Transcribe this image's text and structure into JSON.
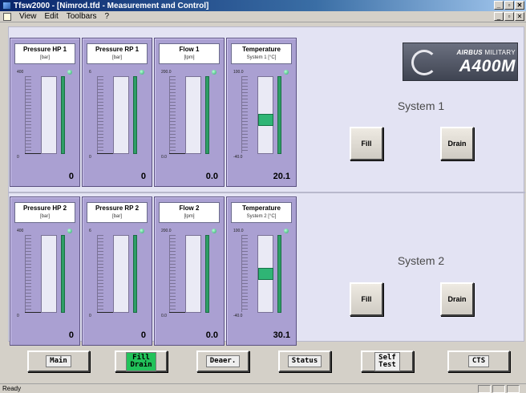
{
  "window": {
    "title": "Tfsw2000 - [Nimrod.tfd - Measurement and Control]"
  },
  "menu": {
    "items": [
      "View",
      "Edit",
      "Toolbars",
      "?"
    ]
  },
  "logo": {
    "brand": "AIRBUS",
    "brand_suffix": "MILITARY",
    "model": "A400M"
  },
  "systems": [
    {
      "title": "System 1",
      "fill_label": "Fill",
      "drain_label": "Drain",
      "gauges": [
        {
          "title": "Pressure HP 1",
          "unit": "[bar]",
          "max": "400",
          "min": "0",
          "value": "0",
          "level": 0
        },
        {
          "title": "Pressure RP 1",
          "unit": "[bar]",
          "max": "6",
          "min": "0",
          "value": "0",
          "level": 0
        },
        {
          "title": "Flow 1",
          "unit": "[lpm]",
          "max": "200.0",
          "min": "0.0",
          "value": "0.0",
          "level": 0
        },
        {
          "title": "Temperature",
          "unit": "System 1 [°C]",
          "max": "100.0",
          "min": "-40.0",
          "value": "20.1",
          "level": 0.43
        }
      ]
    },
    {
      "title": "System 2",
      "fill_label": "Fill",
      "drain_label": "Drain",
      "gauges": [
        {
          "title": "Pressure HP 2",
          "unit": "[bar]",
          "max": "400",
          "min": "0",
          "value": "0",
          "level": 0
        },
        {
          "title": "Pressure RP 2",
          "unit": "[bar]",
          "max": "6",
          "min": "0",
          "value": "0",
          "level": 0
        },
        {
          "title": "Flow 2",
          "unit": "[lpm]",
          "max": "200.0",
          "min": "0.0",
          "value": "0.0",
          "level": 0
        },
        {
          "title": "Temperature",
          "unit": "System 2 [°C]",
          "max": "100.0",
          "min": "-40.0",
          "value": "30.1",
          "level": 0.5
        }
      ]
    }
  ],
  "nav": {
    "main": "Main",
    "fill_drain_1": "Fill",
    "fill_drain_2": "Drain",
    "deaer": "Deaer.",
    "status": "Status",
    "self_test_1": "Self",
    "self_test_2": "Test",
    "cts": "CTS",
    "active": "fill_drain"
  },
  "statusbar": {
    "text": "Ready"
  },
  "colors": {
    "gauge_bg": "#aaa0d2",
    "level_green": "#2fb575",
    "active_nav": "#22c25a",
    "work_bg": "#e3e3f3"
  }
}
